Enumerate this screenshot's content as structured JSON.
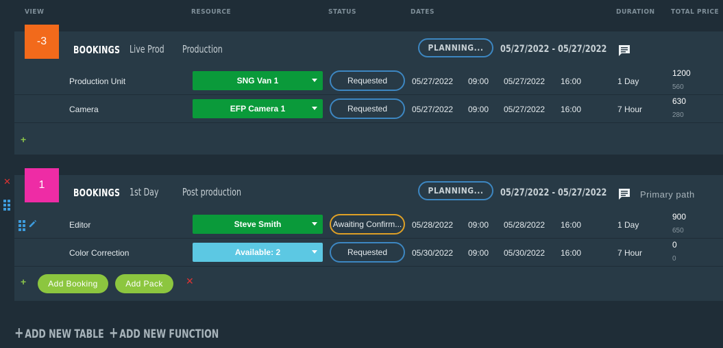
{
  "columns": {
    "view": "VIEW",
    "resource": "RESOURCE",
    "status": "STATUS",
    "dates": "DATES",
    "duration": "DURATION",
    "total_price": "TOTAL PRICE"
  },
  "tables": [
    {
      "badge": "-3",
      "badge_color": "#f26a1b",
      "title": "BOOKINGS",
      "subtitle1": "Live Prod",
      "subtitle2": "Production",
      "phase": "PLANNING...",
      "range": "05/27/2022 - 05/27/2022",
      "path_label": "",
      "rows": [
        {
          "name": "Production Unit",
          "resource": "SNG Van 1",
          "status": "Requested",
          "start_date": "05/27/2022",
          "start_time": "09:00",
          "end_date": "05/27/2022",
          "end_time": "16:00",
          "duration": "1 Day",
          "price": "1200",
          "price_sub": "560"
        },
        {
          "name": "Camera",
          "resource": "EFP Camera 1",
          "status": "Requested",
          "start_date": "05/27/2022",
          "start_time": "09:00",
          "end_date": "05/27/2022",
          "end_time": "16:00",
          "duration": "7 Hour",
          "price": "630",
          "price_sub": "280"
        }
      ]
    },
    {
      "badge": "1",
      "badge_color": "#ee2ca5",
      "title": "BOOKINGS",
      "subtitle1": "1st Day",
      "subtitle2": "Post production",
      "phase": "PLANNING...",
      "range": "05/27/2022 - 05/27/2022",
      "path_label": "Primary path",
      "rows": [
        {
          "name": "Editor",
          "resource": "Steve Smith",
          "status": "Awaiting Confirm...",
          "start_date": "05/28/2022",
          "start_time": "09:00",
          "end_date": "05/28/2022",
          "end_time": "16:00",
          "duration": "1 Day",
          "price": "900",
          "price_sub": "650"
        },
        {
          "name": "Color Correction",
          "resource": "Available: 2",
          "status": "Requested",
          "start_date": "05/30/2022",
          "start_time": "09:00",
          "end_date": "05/30/2022",
          "end_time": "16:00",
          "duration": "7 Hour",
          "price": "0",
          "price_sub": "0"
        }
      ],
      "add_booking_label": "Add Booking",
      "add_pack_label": "Add Pack"
    }
  ],
  "footer": {
    "add_table": "ADD NEW TABLE",
    "add_function": "ADD NEW FUNCTION"
  },
  "colors": {
    "background": "#1f2d37",
    "card": "#283a46",
    "accent_blue": "#3d87c2",
    "resource_green": "#0a9a3a",
    "resource_blue": "#5cc8e3",
    "button_green": "#8cc63f",
    "awaiting_amber": "#e0a126"
  }
}
